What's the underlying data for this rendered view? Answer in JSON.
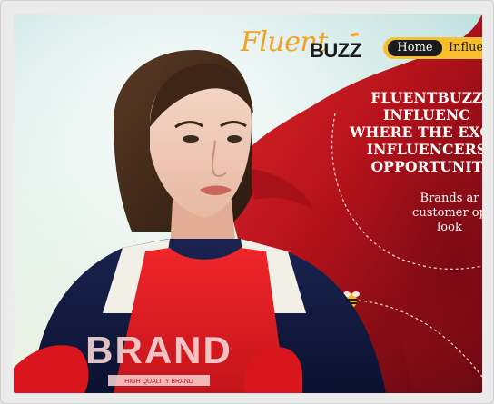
{
  "logo": {
    "script_text": "Fluent",
    "bold_text": "BUZZ",
    "primary_color": "#f4a11f",
    "text_color": "#1a1a1a"
  },
  "nav": {
    "items": [
      {
        "label": "Home",
        "active": true
      },
      {
        "label": "Influen"
      }
    ],
    "pill_color": "#f7bd2b",
    "active_color": "#1b1b1b"
  },
  "hero": {
    "headline_lines": [
      "FLUENTBUZZ",
      "INFLUENC",
      "WHERE THE EXCIT",
      "INFLUENCERS",
      "OPPORTUNIT"
    ],
    "subtext_lines": [
      "Brands ar",
      "customer op",
      "look"
    ],
    "shirt_text": "BRAND",
    "shirt_tagline": "HIGH QUALITY BRAND",
    "cape_color": "#c6161d",
    "suit_color": "#0f1637"
  },
  "icons": {
    "logo_mark": "bee-wings-icon",
    "bee": "bee-icon"
  }
}
